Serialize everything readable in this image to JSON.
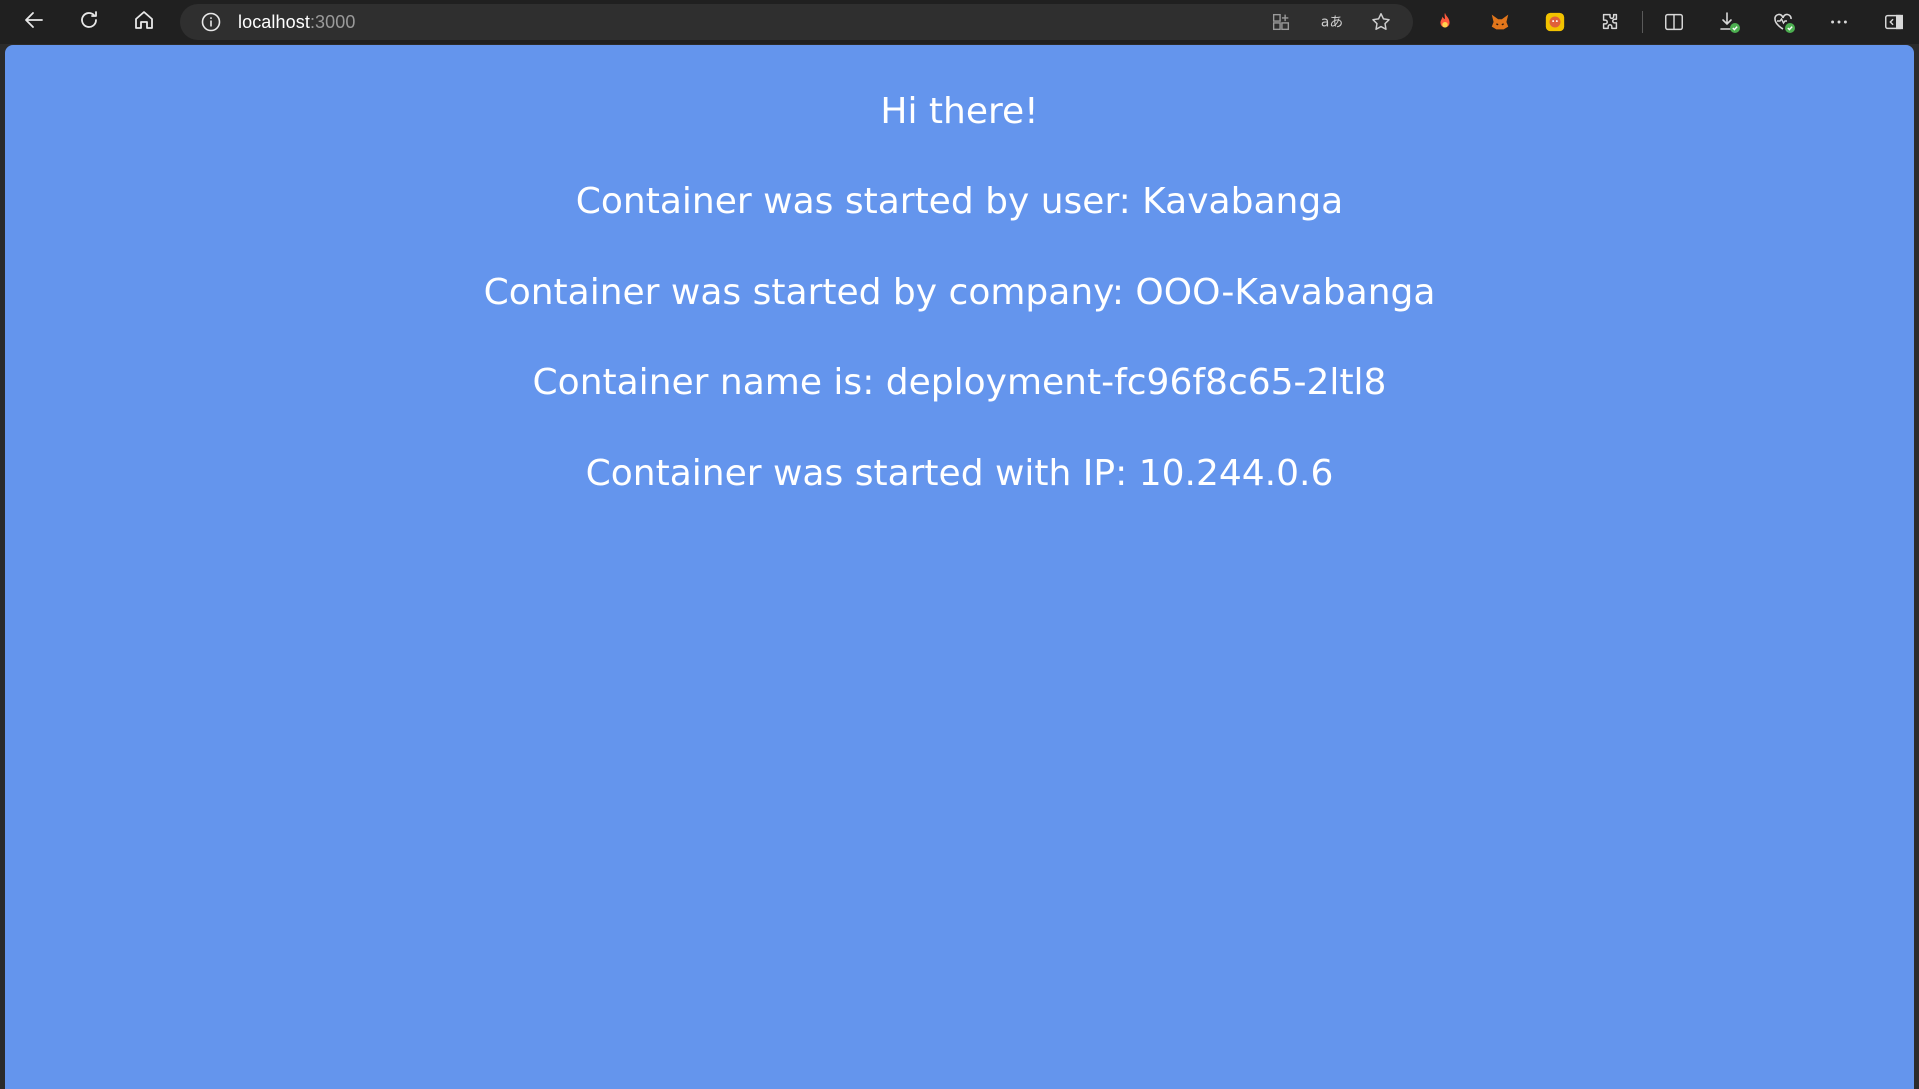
{
  "browser": {
    "url_host": "localhost",
    "url_port": ":3000",
    "toolbar_icons": [
      "back-icon",
      "refresh-icon",
      "home-icon"
    ],
    "address_icons": [
      "app-available-icon",
      "read-aloud-icon",
      "favorite-star-icon"
    ],
    "extension_icons": [
      "fire-extension-icon",
      "metamask-fox-icon",
      "yellow-extension-icon",
      "extensions-puzzle-icon",
      "split-screen-icon",
      "downloads-icon",
      "browser-essentials-icon",
      "more-menu-icon",
      "sidebar-toggle-icon"
    ],
    "colors": {
      "toolbar_bg": "#202020",
      "addressbar_bg": "#2f2f2f",
      "page_bg": "#6495ed"
    }
  },
  "page": {
    "greeting": "Hi there!",
    "user_line": "Container was started by user: Kavabanga",
    "company_line": "Container was started by company: OOO-Kavabanga",
    "name_line": "Container name is: deployment-fc96f8c65-2ltl8",
    "ip_line": "Container was started with IP: 10.244.0.6"
  }
}
